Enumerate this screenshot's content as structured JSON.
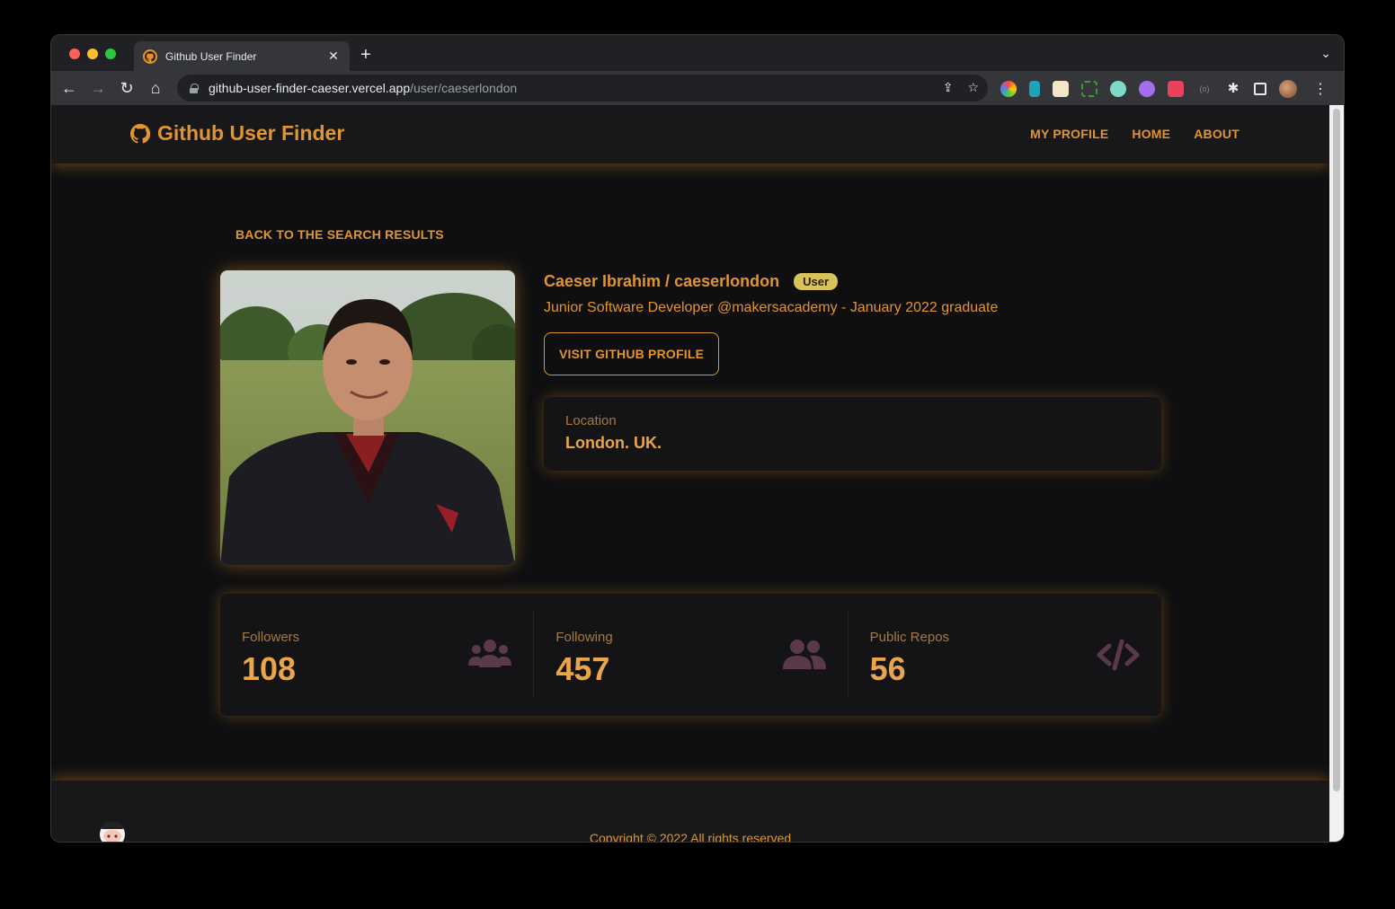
{
  "browser": {
    "tab_title": "Github User Finder",
    "url_host": "github-user-finder-caeser.vercel.app",
    "url_path": "/user/caeserlondon"
  },
  "header": {
    "brand": "Github User Finder",
    "nav": [
      "MY PROFILE",
      "HOME",
      "ABOUT"
    ]
  },
  "page": {
    "back_link": "BACK TO THE SEARCH RESULTS",
    "name": "Caeser Ibrahim / caeserlondon",
    "badge": "User",
    "bio": "Junior Software Developer @makersacademy - January 2022 graduate",
    "visit_button": "VISIT GITHUB PROFILE",
    "location_label": "Location",
    "location_value": "London. UK."
  },
  "stats": [
    {
      "label": "Followers",
      "value": "108",
      "icon": "users-icon"
    },
    {
      "label": "Following",
      "value": "457",
      "icon": "user-friends-icon"
    },
    {
      "label": "Public Repos",
      "value": "56",
      "icon": "code-icon"
    }
  ],
  "footer": {
    "copyright": "Copyright © 2022 All rights reserved"
  },
  "colors": {
    "accent": "#e0952f",
    "badge": "#d9c25a",
    "background": "#0f0f11",
    "icon_muted": "#5a3a4a"
  }
}
